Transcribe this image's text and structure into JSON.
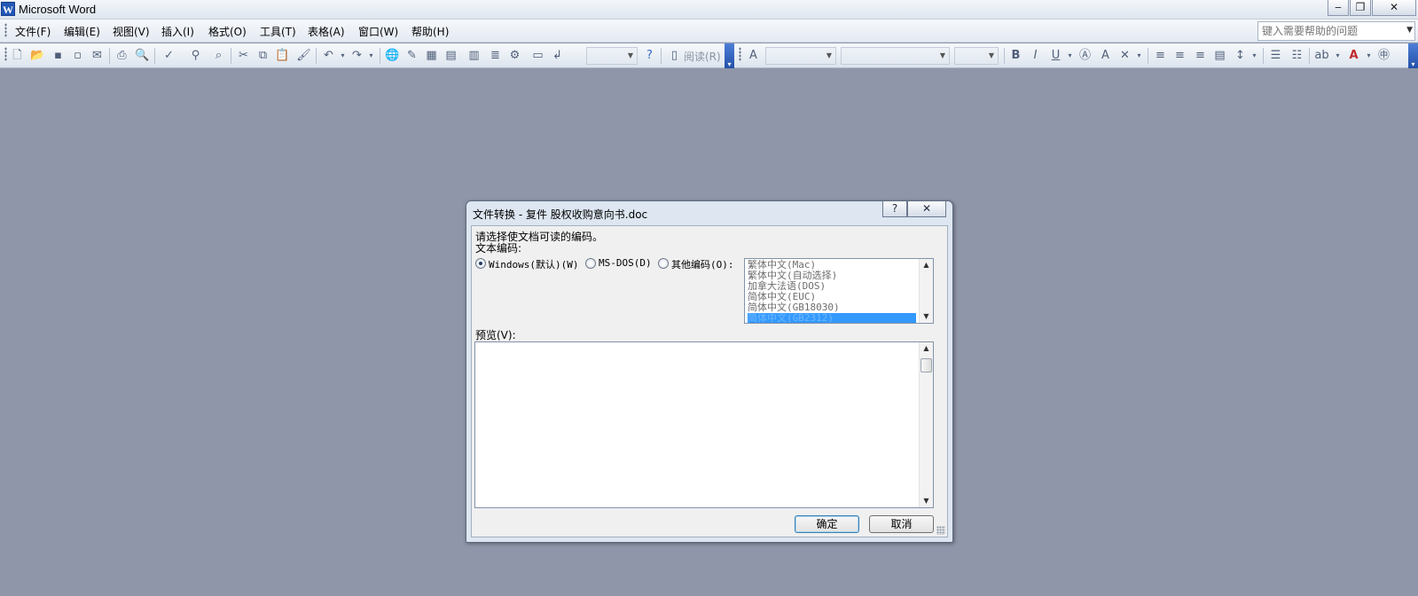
{
  "window": {
    "app_icon_letter": "W",
    "title": "Microsoft Word",
    "minimize": "‒",
    "restore": "❐",
    "close": "✕"
  },
  "menu": {
    "items": [
      "文件(F)",
      "编辑(E)",
      "视图(V)",
      "插入(I)",
      "格式(O)",
      "工具(T)",
      "表格(A)",
      "窗口(W)",
      "帮助(H)"
    ],
    "help_placeholder": "键入需要帮助的问题"
  },
  "toolbar": {
    "read_button": "阅读(R)",
    "icons": [
      "new-icon",
      "open-icon",
      "save-icon",
      "permission-icon",
      "mail-icon",
      "print-icon",
      "print-preview-icon",
      "spelling-icon",
      "research-icon",
      "cut-icon",
      "copy-icon",
      "paste-icon",
      "format-painter-icon",
      "undo-icon",
      "redo-icon",
      "hyperlink-icon",
      "tables-borders-icon",
      "insert-table-icon",
      "insert-excel-icon",
      "columns-icon",
      "drawing-icon",
      "document-map-icon",
      "show-hide-icon",
      "zoom-combo",
      "help-icon"
    ]
  },
  "dialog": {
    "title": "文件转换 - 复件 股权收购意向书.doc",
    "help_btn": "?",
    "close_btn": "✕",
    "instruction": "请选择使文档可读的编码。",
    "encoding_label": "文本编码:",
    "radio_windows": "Windows(默认)(W)",
    "radio_msdos": "MS-DOS(D)",
    "radio_other": "其他编码(O):",
    "selected_radio": "windows",
    "encodings": [
      "繁体中文(Mac)",
      "繁体中文(自动选择)",
      "加拿大法语(DOS)",
      "简体中文(EUC)",
      "简体中文(GB18030)",
      "简体中文(GB2312)"
    ],
    "selected_encoding_index": 5,
    "preview_label": "预览(V):",
    "ok": "确定",
    "cancel": "取消"
  }
}
